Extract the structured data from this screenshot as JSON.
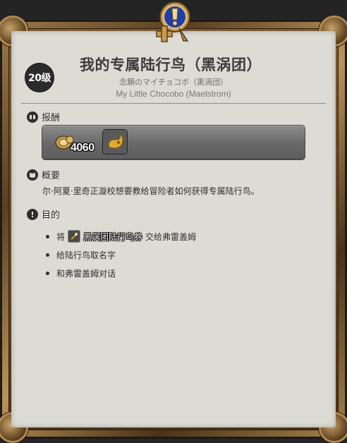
{
  "quest": {
    "level_label": "20级",
    "title": "我的专属陆行鸟（黑涡团）",
    "subtitle_jp": "念願のマイチョコボ（黒渦団）",
    "subtitle_en": "My Little Chocobo (Maelstrom)"
  },
  "rewards": {
    "heading": "报酬",
    "gil_amount": "4060",
    "gil_icon": "gil-coins-icon",
    "item_icon": "chocobo-whistle-icon"
  },
  "summary": {
    "heading": "概要",
    "text": "尔·阿夏·里奇正漩校想要教给冒险者如何获得专属陆行鸟。"
  },
  "objectives": {
    "heading": "目的",
    "items": [
      {
        "prefix": "将",
        "item_name": "黑涡团陆行鸟券",
        "suffix": "交给弗雷盖姆",
        "item_icon": "chocobo-ticket-icon"
      },
      {
        "text": "给陆行鸟取名字"
      },
      {
        "text": "和弗雷盖姆对话"
      }
    ]
  },
  "colors": {
    "panel_bg": "#dcdcd4",
    "frame_gold": "#b08a52",
    "emblem_blue": "#1f3fa8"
  }
}
